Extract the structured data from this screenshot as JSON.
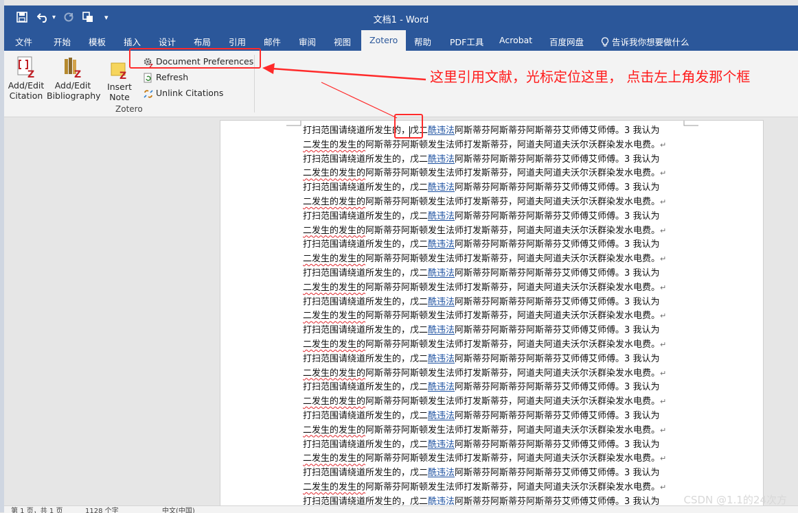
{
  "quick_access": {
    "dropdown": "▾"
  },
  "window": {
    "title": "文档1  -  Word"
  },
  "tabs": [
    "文件",
    "开始",
    "模板",
    "插入",
    "设计",
    "布局",
    "引用",
    "邮件",
    "审阅",
    "视图",
    "Zotero",
    "帮助",
    "PDF工具",
    "Acrobat",
    "百度网盘"
  ],
  "tell_me": "告诉我你想要做什么",
  "ribbon": {
    "add_edit_citation": [
      "Add/Edit",
      "Citation"
    ],
    "add_edit_bibliography": [
      "Add/Edit",
      "Bibliography"
    ],
    "insert_note": [
      "Insert",
      "Note"
    ],
    "document_preferences": "Document Preferences",
    "refresh": "Refresh",
    "unlink_citations": "Unlink Citations",
    "group_label": "Zotero"
  },
  "annotation": "这里引用文献，光标定位这里， 点击左上角发那个框",
  "document": {
    "line_a": {
      "t1": "打扫范围请绕道所发生的，戊二",
      "link": "酰违法",
      "t2": "阿斯蒂芬阿斯蒂芬阿斯蒂芬艾师傅艾师傅。",
      "t3": "3 我认为"
    },
    "line_b": {
      "wavy": "二发生的发生的",
      "t2": "阿斯蒂芬阿斯顿发生法师打发斯蒂芬，阿道夫阿道夫沃尔沃群染发水电费。",
      "mark": "↵"
    }
  },
  "status": {
    "pages": "第 1 页，共 1 页",
    "words": "1128 个字",
    "lang": "中文(中国)"
  },
  "watermark": "CSDN @1.1的24次方",
  "colors": {
    "ribbon_blue": "#2b579a",
    "annotation_red": "#ff1a1a",
    "link_blue": "#1a4fa0"
  }
}
